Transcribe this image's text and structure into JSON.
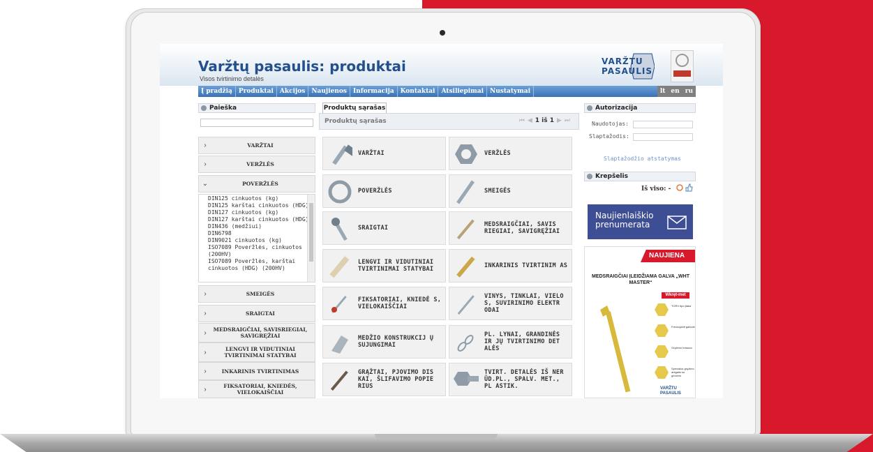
{
  "site": {
    "title": "Varžtų pasaulis: produktai",
    "subtitle": "Visos tvirtinimo detalės",
    "logo_line1": "VARŽTU",
    "logo_line2": "PASAULIS"
  },
  "nav": {
    "items": [
      "Į pradžią",
      "Produktai",
      "Akcijos",
      "Naujienos",
      "Informacija",
      "Kontaktai",
      "Atsiliepimai",
      "Nustatymai"
    ],
    "langs": [
      "lt",
      "en",
      "ru"
    ]
  },
  "left": {
    "search_title": "Paieška",
    "categories_top": [
      "VARŽTAI",
      "VERŽLĖS",
      "POVERŽLĖS"
    ],
    "subitems": [
      "DIN125 cinkuotos (kg)",
      "DIN125 karštai cinkuotos (HDG)",
      "DIN127 cinkuotos (kg)",
      "DIN127 karštai cinkuotos (HDG)",
      "DIN436 (medžiui)",
      "DIN6798",
      "DIN9021 cinkuotos (kg)",
      "ISO7089 Poveržlės, cinkuotos (200HV)",
      "ISO7089 Poveržlės, karštai cinkuotos (HDG) (200HV)"
    ],
    "categories_bottom": [
      "SMEIGĖS",
      "SRAIGTAI",
      "MEDSRAIGČIAI, SAVISRIEGIAI, SAVIGRĘŽIAI",
      "LENGVI IR VIDUTINIAI TVIRTINIMAI STATYBAI",
      "INKARINIS TVIRTINIMAS",
      "FIKSATORIAI, KNIEDĖS, VIELOKAIŠČIAI"
    ]
  },
  "middle": {
    "tab": "Produktų sąrašas",
    "bar_title": "Produktų sąrašas",
    "pager": "1 iš 1",
    "products": [
      "VARŽTAI",
      "VERŽLĖS",
      "POVERŽLĖS",
      "SMEIGĖS",
      "SRAIGTAI",
      "MEDSRAIGČIAI, SAVIS RIEGIAI, SAVIGRĘŽIAI",
      "LENGVI IR VIDUTINIAI TVIRTINIMAI STATYBAI",
      "INKARINIS TVIRTINIM AS",
      "FIKSATORIAI, KNIEDĖ S, VIELOKAIŠČIAI",
      "VINYS, TINKLAI, VIELO S, SUVIRINIMO ELEKTR ODAI",
      "MEDŽIO KONSTRUKCIJ Ų SUJUNGIMAI",
      "PL. LYNAI, GRANDINĖS IR JŲ TVIRTINIMO DET ALĖS",
      "GRĄŽTAI, PJOVIMO DIS KAI, ŠLIFAVIMO POPIE RIUS",
      "TVIRT. DETALĖS IŠ NER ŪD.PL., SPALV. MET., PL ASTIK."
    ]
  },
  "right": {
    "auth_title": "Autorizacija",
    "user_label": "Naudotojas:",
    "pass_label": "Slaptažodis:",
    "reset_link": "Slaptažodžio atstatymas",
    "cart_title": "Krepšelis",
    "cart_total": "Iš viso: -",
    "newsletter": "Naujienlaiškio prenumerata",
    "promo_ribbon": "NAUJIENA",
    "promo_title": "MEDSRAIGČIAI ĮLEIDŽIAMA GALVA „WHT MASTER“",
    "promo_badge": "Wkręt-met",
    "promo_notes": [
      "TORX tipo įtaka",
      "Frezuojanti galvutė",
      "Gręžimo briauna",
      "Specialus gręžimo antgalis su griovelu"
    ],
    "promo_logo": "VARŽTU PASAULIS"
  },
  "colors": {
    "brand_blue": "#23508c",
    "accent_red": "#d7192b",
    "nav_blue": "#3a72b5"
  }
}
